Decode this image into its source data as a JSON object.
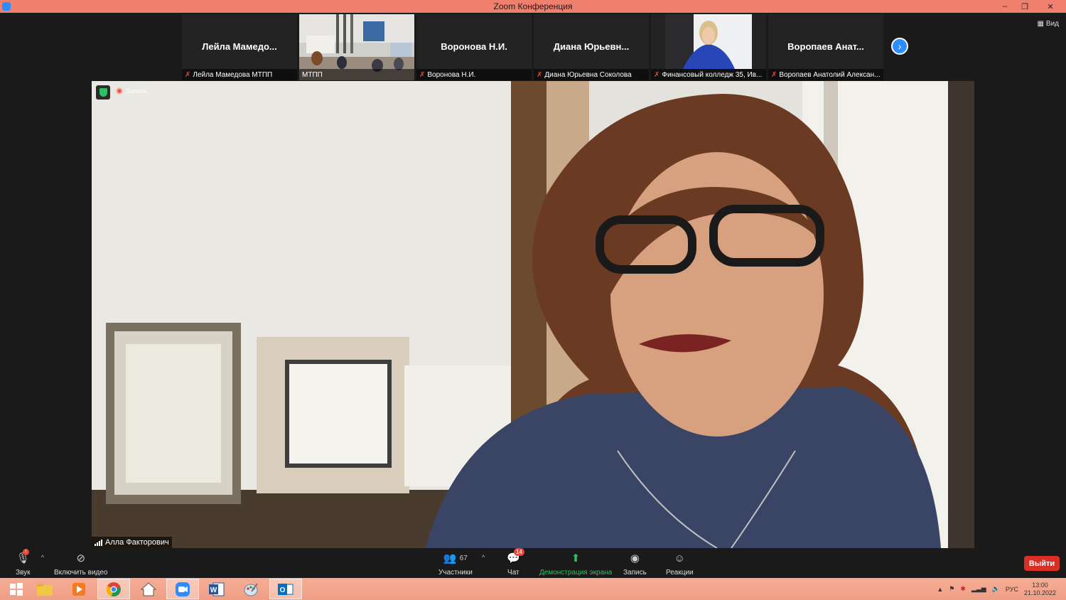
{
  "window": {
    "title": "Zoom Конференция",
    "controls": {
      "minimize": "–",
      "restore": "❐",
      "close": "✕"
    }
  },
  "view_button": "Вид",
  "participants_strip": [
    {
      "display_name": "Лейла  Мамедо...",
      "caption": "Лейла Мамедова МТПП",
      "muted": true,
      "video": false
    },
    {
      "display_name": "",
      "caption": "МТПП",
      "muted": false,
      "video": true
    },
    {
      "display_name": "Воронова Н.И.",
      "caption": "Воронова Н.И.",
      "muted": true,
      "video": false
    },
    {
      "display_name": "Диана  Юрьевн...",
      "caption": "Диана Юрьевна Соколова",
      "muted": true,
      "video": false
    },
    {
      "display_name": "",
      "caption": "Финансовый колледж 35, Ив...",
      "muted": true,
      "video": true
    },
    {
      "display_name": "Воропаев  Анат...",
      "caption": "Воропаев Анатолий Алексан...",
      "muted": true,
      "video": false
    }
  ],
  "main_video": {
    "recording_label": "Запись",
    "speaker_name": "Алла Факторович"
  },
  "toolbar": {
    "audio_label": "Звук",
    "video_label": "Включить видео",
    "participants_label": "Участники",
    "participants_count": "67",
    "chat_label": "Чат",
    "chat_badge": "14",
    "share_label": "Демонстрация экрана",
    "record_label": "Запись",
    "reactions_label": "Реакции",
    "leave_label": "Выйти"
  },
  "taskbar": {
    "language": "РУС",
    "time": "13:00",
    "date": "21.10.2022"
  },
  "colors": {
    "titlebar": "#f0806e",
    "accent_blue": "#2d8cff",
    "share_green": "#2fc15f",
    "leave_red": "#d93025",
    "taskbar": "#f2a68e"
  }
}
